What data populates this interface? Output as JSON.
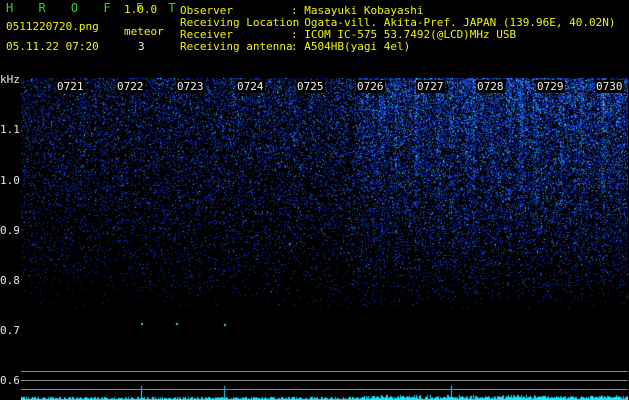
{
  "header": {
    "app_name": "H R O F F T",
    "version": "1.0.0",
    "filename": "0511220720.png",
    "datetime": "05.11.22 07:20",
    "meteor_label": "meteor",
    "meteor_count": "3",
    "fields": [
      {
        "label": "Observer",
        "value": ": Masayuki Kobayashi"
      },
      {
        "label": "Receiving Location",
        "value": ": Ogata-vill. Akita-Pref. JAPAN (139.96E, 40.02N)"
      },
      {
        "label": "Receiver",
        "value": ": ICOM IC-575 53.7492(@LCD)MHz USB"
      },
      {
        "label": "Receiving antenna",
        "value": ": A504HB(yagi 4el)"
      }
    ]
  },
  "axis": {
    "y_unit": "kHz",
    "y_ticks": [
      "1.1",
      "1.0",
      "0.9",
      "0.8",
      "0.7",
      "0.6"
    ],
    "time_labels": [
      "0721",
      "0722",
      "0723",
      "0724",
      "0725",
      "0726",
      "0727",
      "0728",
      "0729",
      "0730"
    ]
  },
  "colors": {
    "background": "#000000",
    "noise": "#1e3cc8",
    "bright": "#1ee6ff",
    "title": "#f2f20a",
    "accent": "#2fd12f"
  }
}
